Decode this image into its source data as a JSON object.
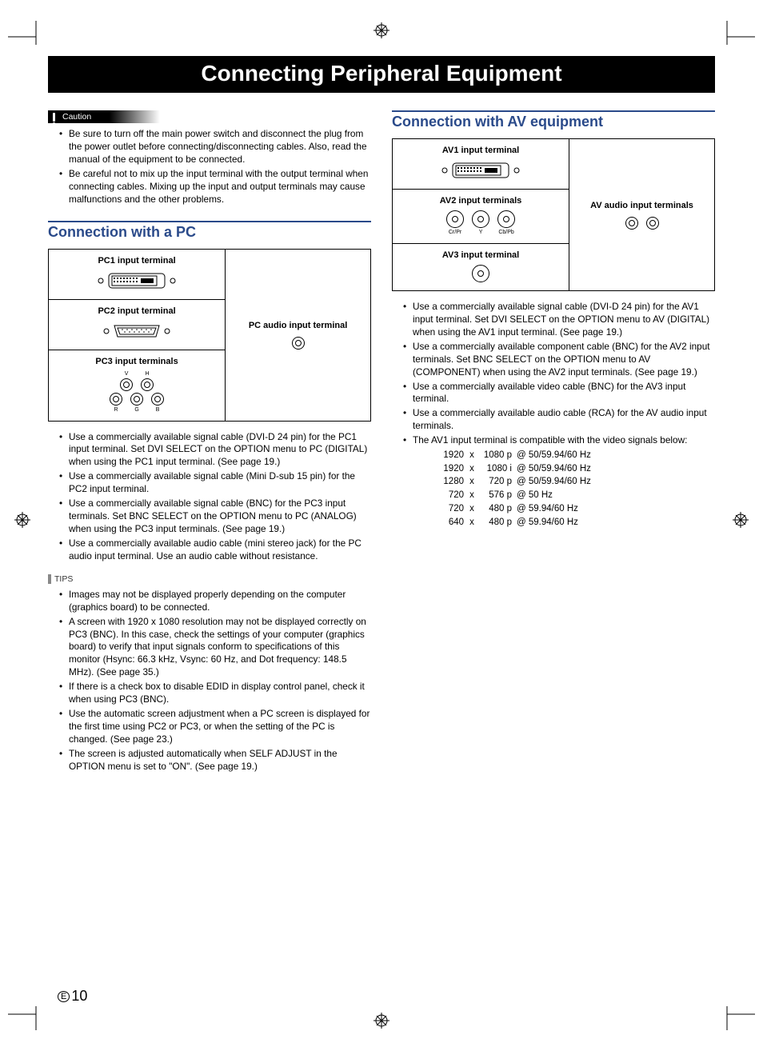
{
  "title": "Connecting Peripheral Equipment",
  "caution_label": "Caution",
  "caution_items": [
    "Be sure to turn off the main power switch and disconnect the plug from the power outlet before connecting/disconnecting cables. Also, read the manual of the equipment to be connected.",
    "Be careful not to mix up the input terminal with the output terminal when connecting cables. Mixing up the input and output terminals may cause malfunctions and the other problems."
  ],
  "pc_section": "Connection with a PC",
  "pc_box": {
    "left": [
      {
        "label": "PC1 input terminal",
        "icon": "dvi"
      },
      {
        "label": "PC2 input terminal",
        "icon": "dsub"
      },
      {
        "label": "PC3 input terminals",
        "icon": "bnc5"
      }
    ],
    "right_label": "PC audio input terminal"
  },
  "pc_bullets": [
    "Use a commercially available signal cable (DVI-D 24 pin) for the PC1 input terminal. Set DVI SELECT on the OPTION menu to PC (DIGITAL) when using the PC1 input terminal. (See page 19.)",
    "Use a commercially available signal cable (Mini D-sub 15 pin) for the PC2 input terminal.",
    "Use a commercially available signal cable (BNC) for the PC3 input terminals. Set BNC SELECT on the OPTION menu to PC (ANALOG) when using the PC3 input terminals. (See page 19.)",
    "Use a commercially available audio cable (mini stereo jack) for the PC audio input terminal. Use an audio cable without resistance."
  ],
  "tips_label": "TIPS",
  "tips_items": [
    "Images may not be displayed properly depending on the computer (graphics board) to be connected.",
    "A screen with 1920 x 1080 resolution may not be displayed correctly on PC3 (BNC). In this case, check the settings of your computer (graphics board) to verify that input signals conform to specifications of this monitor (Hsync: 66.3 kHz, Vsync: 60 Hz, and Dot frequency: 148.5 MHz). (See page 35.)",
    "If there is a check box to disable EDID in display control panel, check it when using PC3 (BNC).",
    "Use the automatic screen adjustment when a PC screen is displayed for the first time using PC2 or PC3, or when the setting of the PC is changed. (See page 23.)",
    "The screen is adjusted automatically when SELF ADJUST in the OPTION menu is set to \"ON\". (See page 19.)"
  ],
  "av_section": "Connection with AV equipment",
  "av_box": {
    "left": [
      {
        "label": "AV1 input terminal",
        "icon": "dvi"
      },
      {
        "label": "AV2 input terminals",
        "icon": "bnc3",
        "sub": [
          "Cr/Pr",
          "Y",
          "Cb/Pb"
        ]
      },
      {
        "label": "AV3 input terminal",
        "icon": "bnc1"
      }
    ],
    "right_label": "AV audio input terminals"
  },
  "av_bullets": [
    "Use a commercially available signal cable (DVI-D 24 pin) for the AV1 input terminal. Set DVI SELECT on the OPTION menu to AV (DIGITAL) when using the AV1 input terminal. (See page 19.)",
    "Use a commercially available component cable (BNC) for the AV2 input terminals. Set BNC SELECT on the OPTION menu to AV (COMPONENT) when using the AV2 input terminals. (See page 19.)",
    "Use a commercially available video cable (BNC) for the AV3 input terminal.",
    "Use a commercially available audio cable (RCA) for the AV audio input terminals.",
    "The AV1 input terminal is compatible with the video signals below:"
  ],
  "signal_rows": [
    {
      "w": "1920",
      "h": "1080 p",
      "r": "@ 50/59.94/60 Hz"
    },
    {
      "w": "1920",
      "h": "1080 i",
      "r": "@ 50/59.94/60 Hz"
    },
    {
      "w": "1280",
      "h": "720 p",
      "r": "@ 50/59.94/60 Hz"
    },
    {
      "w": "720",
      "h": "576 p",
      "r": "@ 50 Hz"
    },
    {
      "w": "720",
      "h": "480 p",
      "r": "@ 59.94/60 Hz"
    },
    {
      "w": "640",
      "h": "480 p",
      "r": "@ 59.94/60 Hz"
    }
  ],
  "bnc5_labels_top": [
    "V",
    "H"
  ],
  "bnc5_labels_bot": [
    "R",
    "G",
    "B"
  ],
  "page_number": "10",
  "page_lang": "E"
}
